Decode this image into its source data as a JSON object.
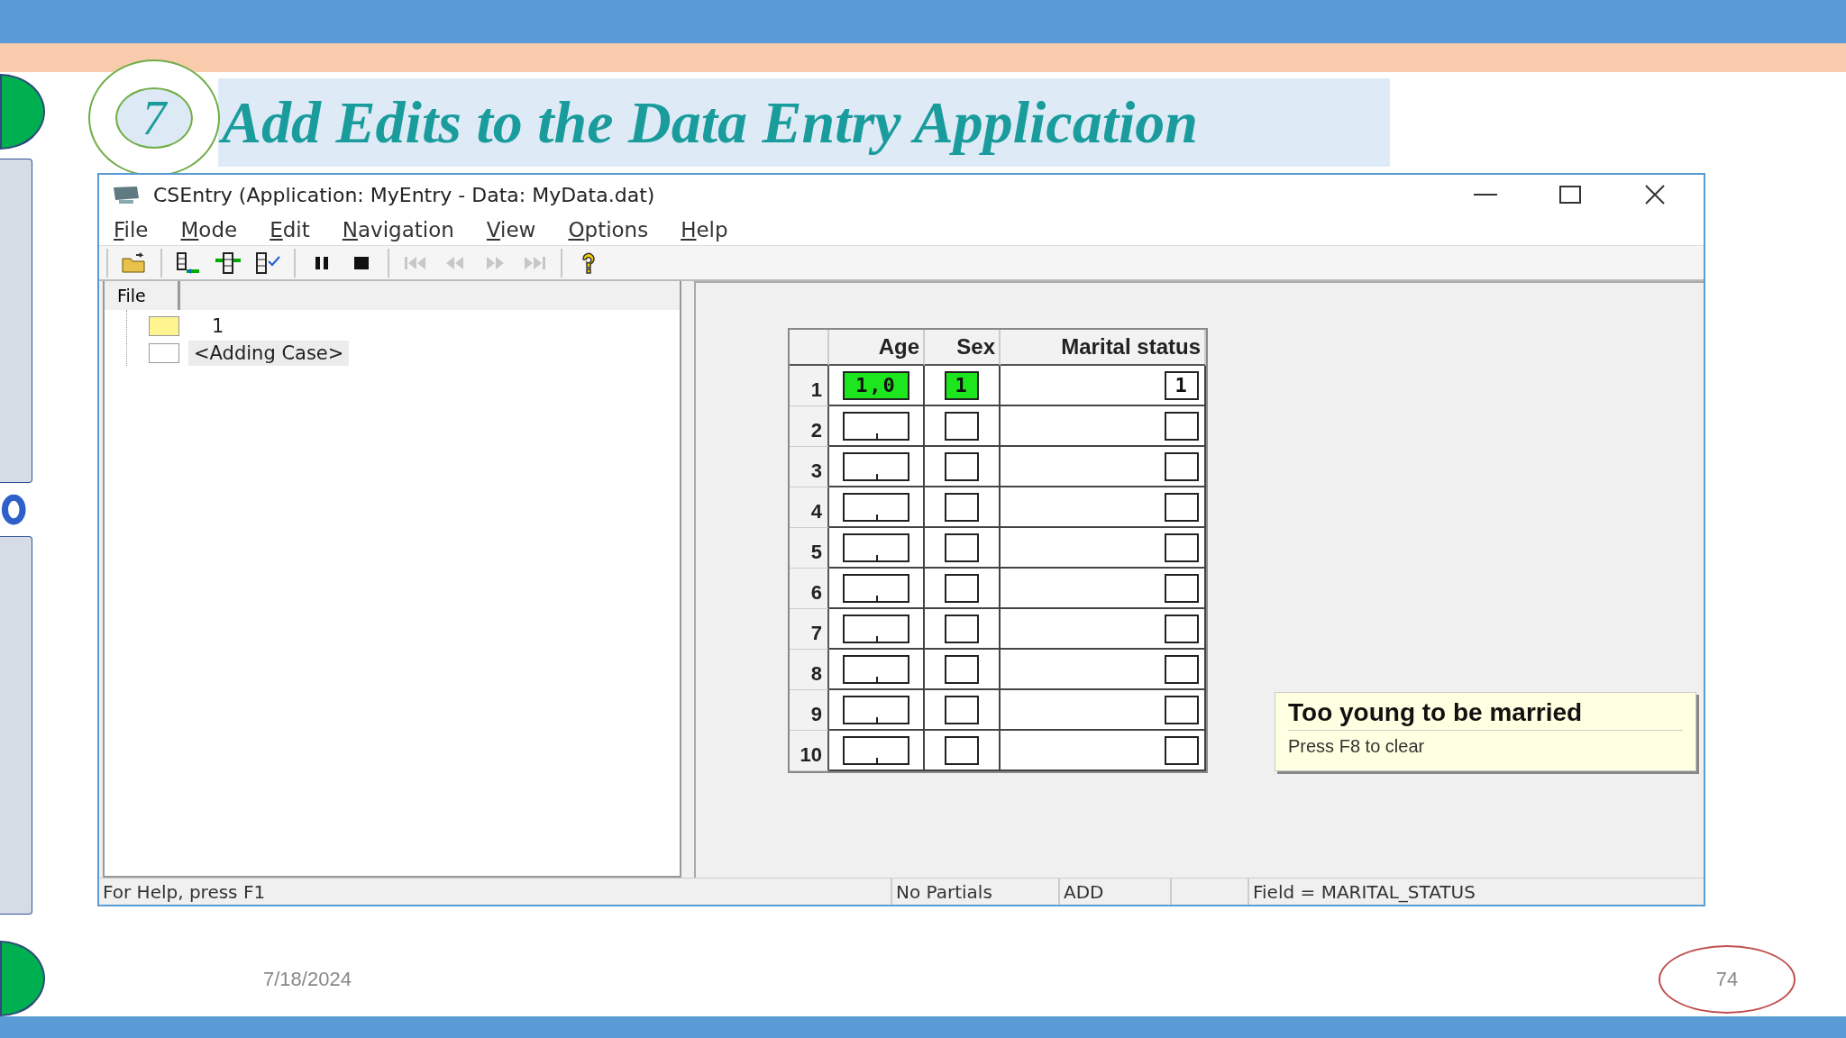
{
  "slide": {
    "number_badge": "7",
    "title": "Add Edits to the Data Entry Application",
    "date": "7/18/2024",
    "page_number": "74"
  },
  "window": {
    "title": "CSEntry (Application: MyEntry - Data: MyData.dat)"
  },
  "menu": [
    "File",
    "Mode",
    "Edit",
    "Navigation",
    "View",
    "Options",
    "Help"
  ],
  "toolbar_groups": [
    [
      {
        "kind": "open",
        "disabled": false
      }
    ],
    [
      {
        "kind": "add",
        "disabled": false
      },
      {
        "kind": "insert",
        "disabled": false
      },
      {
        "kind": "verify",
        "disabled": false
      }
    ],
    [
      {
        "kind": "pause",
        "disabled": false
      },
      {
        "kind": "stop",
        "disabled": false
      }
    ],
    [
      {
        "kind": "first",
        "disabled": true
      },
      {
        "kind": "previous",
        "disabled": true
      },
      {
        "kind": "next",
        "disabled": true
      },
      {
        "kind": "last",
        "disabled": true
      }
    ],
    [
      {
        "kind": "help",
        "disabled": false
      }
    ]
  ],
  "tree": {
    "tab": "File",
    "items": [
      {
        "kind": "case",
        "label": "1",
        "selected": false
      },
      {
        "kind": "new",
        "label": "<Adding Case>",
        "selected": true
      }
    ]
  },
  "grid": {
    "columns": [
      "Age",
      "Sex",
      "Marital status"
    ],
    "rows": [
      {
        "number": "1",
        "cells": [
          {
            "value": "1,0",
            "completed": true
          },
          {
            "value": "1",
            "completed": true
          },
          {
            "value": "1",
            "completed": false
          }
        ]
      },
      {
        "number": "2",
        "cells": [
          {
            "completed": false
          },
          {
            "completed": false
          },
          {
            "completed": false
          }
        ]
      },
      {
        "number": "3",
        "cells": [
          {
            "completed": false
          },
          {
            "completed": false
          },
          {
            "completed": false
          }
        ]
      },
      {
        "number": "4",
        "cells": [
          {
            "completed": false
          },
          {
            "completed": false
          },
          {
            "completed": false
          }
        ]
      },
      {
        "number": "5",
        "cells": [
          {
            "completed": false
          },
          {
            "completed": false
          },
          {
            "completed": false
          }
        ]
      },
      {
        "number": "6",
        "cells": [
          {
            "completed": false
          },
          {
            "completed": false
          },
          {
            "completed": false
          }
        ]
      },
      {
        "number": "7",
        "cells": [
          {
            "completed": false
          },
          {
            "completed": false
          },
          {
            "completed": false
          }
        ]
      },
      {
        "number": "8",
        "cells": [
          {
            "completed": false
          },
          {
            "completed": false
          },
          {
            "completed": false
          }
        ]
      },
      {
        "number": "9",
        "cells": [
          {
            "completed": false
          },
          {
            "completed": false
          },
          {
            "completed": false
          }
        ]
      },
      {
        "number": "10",
        "cells": [
          {
            "completed": false
          },
          {
            "completed": false
          },
          {
            "completed": false
          }
        ]
      }
    ]
  },
  "message": {
    "title": "Too young to be married",
    "hint": "Press F8 to clear"
  },
  "status_bar": {
    "help": "For Help, press F1",
    "panes": [
      "No Partials",
      "ADD"
    ],
    "field": "Field = MARITAL_STATUS"
  }
}
